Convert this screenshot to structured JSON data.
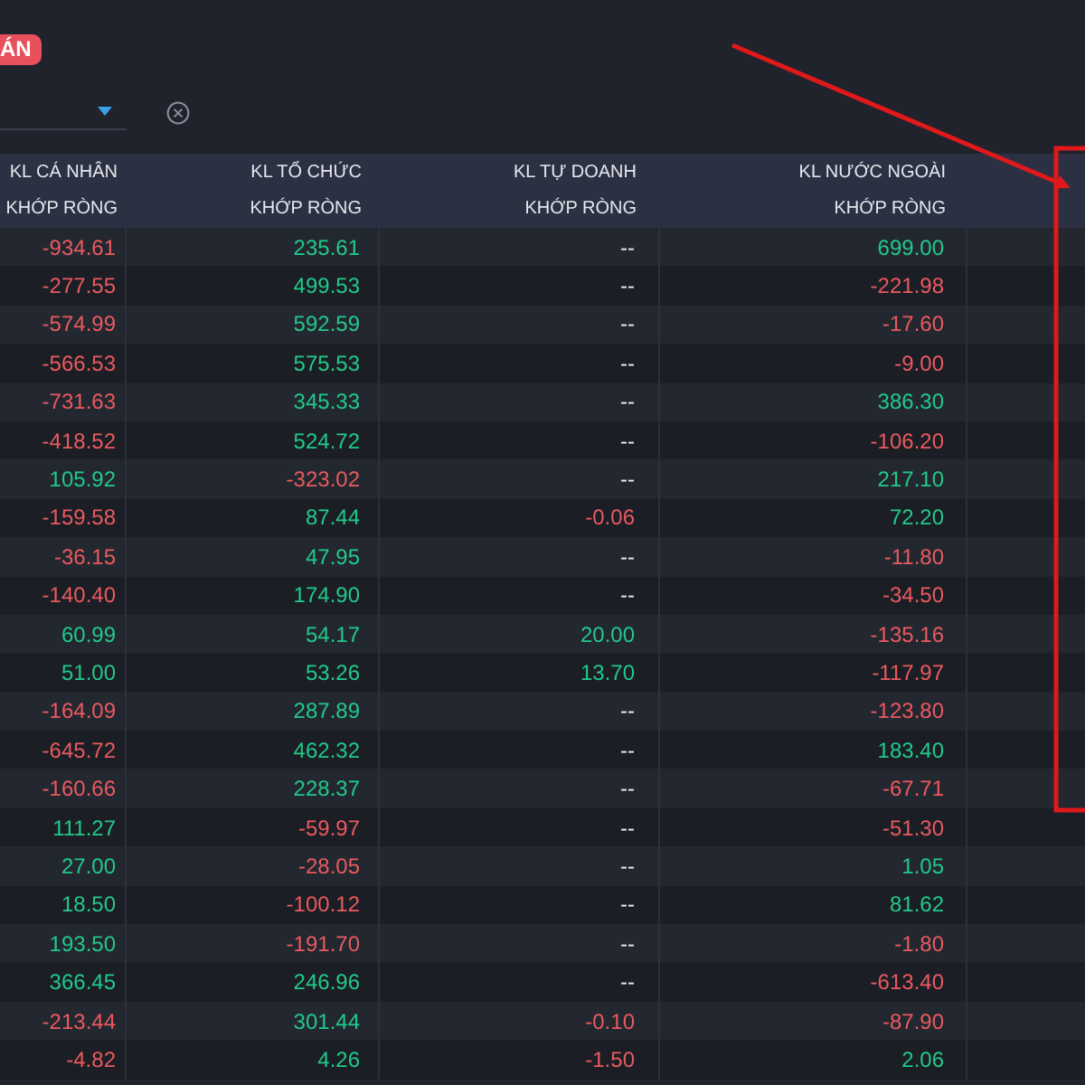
{
  "badge": "ÁN",
  "table": {
    "columns": [
      {
        "lines": [
          "KL CÁ NHÂN",
          "KHỚP RÒNG"
        ]
      },
      {
        "lines": [
          "KL TỔ CHỨC",
          "KHỚP RÒNG"
        ]
      },
      {
        "lines": [
          "KL TỰ DOANH",
          "KHỚP RÒNG"
        ]
      },
      {
        "lines": [
          "KL NƯỚC NGOÀI",
          "KHỚP RÒNG"
        ]
      }
    ],
    "rows": [
      {
        "cells": [
          {
            "text": "-934.61",
            "color": "#ea5a5f"
          },
          {
            "text": "235.61",
            "color": "#22c98a"
          },
          {
            "text": "--",
            "color": "#e6e8ee"
          },
          {
            "text": "699.00",
            "color": "#22c98a"
          }
        ]
      },
      {
        "cells": [
          {
            "text": "-277.55",
            "color": "#ea5a5f"
          },
          {
            "text": "499.53",
            "color": "#22c98a"
          },
          {
            "text": "--",
            "color": "#e6e8ee"
          },
          {
            "text": "-221.98",
            "color": "#ea5a5f"
          }
        ]
      },
      {
        "cells": [
          {
            "text": "-574.99",
            "color": "#ea5a5f"
          },
          {
            "text": "592.59",
            "color": "#22c98a"
          },
          {
            "text": "--",
            "color": "#e6e8ee"
          },
          {
            "text": "-17.60",
            "color": "#ea5a5f"
          }
        ]
      },
      {
        "cells": [
          {
            "text": "-566.53",
            "color": "#ea5a5f"
          },
          {
            "text": "575.53",
            "color": "#22c98a"
          },
          {
            "text": "--",
            "color": "#e6e8ee"
          },
          {
            "text": "-9.00",
            "color": "#ea5a5f"
          }
        ]
      },
      {
        "cells": [
          {
            "text": "-731.63",
            "color": "#ea5a5f"
          },
          {
            "text": "345.33",
            "color": "#22c98a"
          },
          {
            "text": "--",
            "color": "#e6e8ee"
          },
          {
            "text": "386.30",
            "color": "#22c98a"
          }
        ]
      },
      {
        "cells": [
          {
            "text": "-418.52",
            "color": "#ea5a5f"
          },
          {
            "text": "524.72",
            "color": "#22c98a"
          },
          {
            "text": "--",
            "color": "#e6e8ee"
          },
          {
            "text": "-106.20",
            "color": "#ea5a5f"
          }
        ]
      },
      {
        "cells": [
          {
            "text": "105.92",
            "color": "#22c98a"
          },
          {
            "text": "-323.02",
            "color": "#ea5a5f"
          },
          {
            "text": "--",
            "color": "#e6e8ee"
          },
          {
            "text": "217.10",
            "color": "#22c98a"
          }
        ]
      },
      {
        "cells": [
          {
            "text": "-159.58",
            "color": "#ea5a5f"
          },
          {
            "text": "87.44",
            "color": "#22c98a"
          },
          {
            "text": "-0.06",
            "color": "#ea5a5f"
          },
          {
            "text": "72.20",
            "color": "#22c98a"
          }
        ]
      },
      {
        "cells": [
          {
            "text": "-36.15",
            "color": "#ea5a5f"
          },
          {
            "text": "47.95",
            "color": "#22c98a"
          },
          {
            "text": "--",
            "color": "#e6e8ee"
          },
          {
            "text": "-11.80",
            "color": "#ea5a5f"
          }
        ]
      },
      {
        "cells": [
          {
            "text": "-140.40",
            "color": "#ea5a5f"
          },
          {
            "text": "174.90",
            "color": "#22c98a"
          },
          {
            "text": "--",
            "color": "#e6e8ee"
          },
          {
            "text": "-34.50",
            "color": "#ea5a5f"
          }
        ]
      },
      {
        "cells": [
          {
            "text": "60.99",
            "color": "#22c98a"
          },
          {
            "text": "54.17",
            "color": "#22c98a"
          },
          {
            "text": "20.00",
            "color": "#22c98a"
          },
          {
            "text": "-135.16",
            "color": "#ea5a5f"
          }
        ]
      },
      {
        "cells": [
          {
            "text": "51.00",
            "color": "#22c98a"
          },
          {
            "text": "53.26",
            "color": "#22c98a"
          },
          {
            "text": "13.70",
            "color": "#22c98a"
          },
          {
            "text": "-117.97",
            "color": "#ea5a5f"
          }
        ]
      },
      {
        "cells": [
          {
            "text": "-164.09",
            "color": "#ea5a5f"
          },
          {
            "text": "287.89",
            "color": "#22c98a"
          },
          {
            "text": "--",
            "color": "#e6e8ee"
          },
          {
            "text": "-123.80",
            "color": "#ea5a5f"
          }
        ]
      },
      {
        "cells": [
          {
            "text": "-645.72",
            "color": "#ea5a5f"
          },
          {
            "text": "462.32",
            "color": "#22c98a"
          },
          {
            "text": "--",
            "color": "#e6e8ee"
          },
          {
            "text": "183.40",
            "color": "#22c98a"
          }
        ]
      },
      {
        "cells": [
          {
            "text": "-160.66",
            "color": "#ea5a5f"
          },
          {
            "text": "228.37",
            "color": "#22c98a"
          },
          {
            "text": "--",
            "color": "#e6e8ee"
          },
          {
            "text": "-67.71",
            "color": "#ea5a5f"
          }
        ]
      },
      {
        "cells": [
          {
            "text": "111.27",
            "color": "#22c98a"
          },
          {
            "text": "-59.97",
            "color": "#ea5a5f"
          },
          {
            "text": "--",
            "color": "#e6e8ee"
          },
          {
            "text": "-51.30",
            "color": "#ea5a5f"
          }
        ]
      },
      {
        "cells": [
          {
            "text": "27.00",
            "color": "#22c98a"
          },
          {
            "text": "-28.05",
            "color": "#ea5a5f"
          },
          {
            "text": "--",
            "color": "#e6e8ee"
          },
          {
            "text": "1.05",
            "color": "#22c98a"
          }
        ]
      },
      {
        "cells": [
          {
            "text": "18.50",
            "color": "#22c98a"
          },
          {
            "text": "-100.12",
            "color": "#ea5a5f"
          },
          {
            "text": "--",
            "color": "#e6e8ee"
          },
          {
            "text": "81.62",
            "color": "#22c98a"
          }
        ]
      },
      {
        "cells": [
          {
            "text": "193.50",
            "color": "#22c98a"
          },
          {
            "text": "-191.70",
            "color": "#ea5a5f"
          },
          {
            "text": "--",
            "color": "#e6e8ee"
          },
          {
            "text": "-1.80",
            "color": "#ea5a5f"
          }
        ]
      },
      {
        "cells": [
          {
            "text": "366.45",
            "color": "#22c98a"
          },
          {
            "text": "246.96",
            "color": "#22c98a"
          },
          {
            "text": "--",
            "color": "#e6e8ee"
          },
          {
            "text": "-613.40",
            "color": "#ea5a5f"
          }
        ]
      },
      {
        "cells": [
          {
            "text": "-213.44",
            "color": "#ea5a5f"
          },
          {
            "text": "301.44",
            "color": "#22c98a"
          },
          {
            "text": "-0.10",
            "color": "#ea5a5f"
          },
          {
            "text": "-87.90",
            "color": "#ea5a5f"
          }
        ]
      },
      {
        "cells": [
          {
            "text": "-4.82",
            "color": "#ea5a5f"
          },
          {
            "text": "4.26",
            "color": "#22c98a"
          },
          {
            "text": "-1.50",
            "color": "#ea5a5f"
          },
          {
            "text": "2.06",
            "color": "#22c98a"
          }
        ]
      }
    ]
  }
}
